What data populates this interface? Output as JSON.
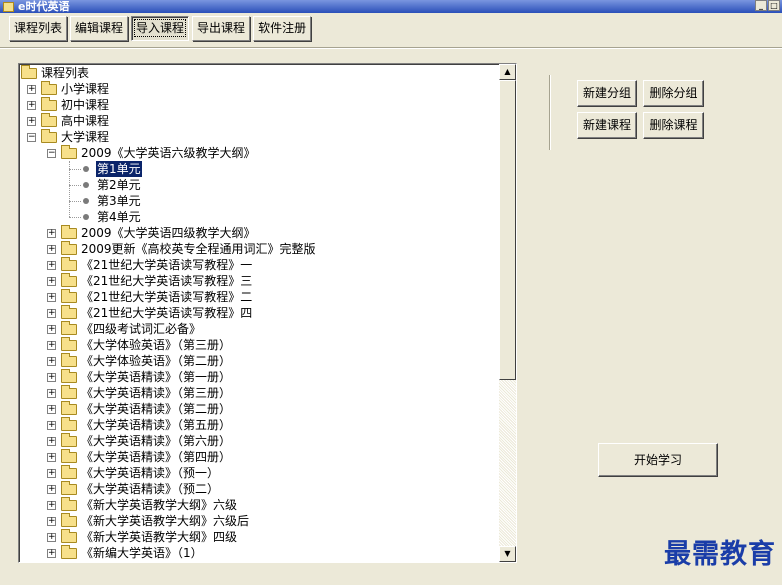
{
  "window": {
    "title": "e时代英语",
    "controls": [
      "_",
      "□"
    ]
  },
  "toolbar": [
    {
      "label": "课程列表",
      "active": false
    },
    {
      "label": "编辑课程",
      "active": false
    },
    {
      "label": "导入课程",
      "active": true
    },
    {
      "label": "导出课程",
      "active": false
    },
    {
      "label": "软件注册",
      "active": false
    }
  ],
  "tree": {
    "root": "课程列表",
    "nodes": [
      {
        "label": "小学课程",
        "level": 1,
        "type": "folder",
        "expanded": false
      },
      {
        "label": "初中课程",
        "level": 1,
        "type": "folder",
        "expanded": false
      },
      {
        "label": "高中课程",
        "level": 1,
        "type": "folder",
        "expanded": false
      },
      {
        "label": "大学课程",
        "level": 1,
        "type": "folder",
        "expanded": true
      },
      {
        "label": "2009《大学英语六级教学大纲》",
        "level": 2,
        "type": "folder",
        "expanded": true
      },
      {
        "label": "第1单元",
        "level": 3,
        "type": "leaf",
        "selected": true
      },
      {
        "label": "第2单元",
        "level": 3,
        "type": "leaf"
      },
      {
        "label": "第3单元",
        "level": 3,
        "type": "leaf"
      },
      {
        "label": "第4单元",
        "level": 3,
        "type": "leaf"
      },
      {
        "label": "2009《大学英语四级教学大纲》",
        "level": 2,
        "type": "folder",
        "expanded": false
      },
      {
        "label": "2009更新《高校英专全程通用词汇》完整版",
        "level": 2,
        "type": "folder",
        "expanded": false
      },
      {
        "label": "《21世纪大学英语读写教程》一",
        "level": 2,
        "type": "folder",
        "expanded": false
      },
      {
        "label": "《21世纪大学英语读写教程》三",
        "level": 2,
        "type": "folder",
        "expanded": false
      },
      {
        "label": "《21世纪大学英语读写教程》二",
        "level": 2,
        "type": "folder",
        "expanded": false
      },
      {
        "label": "《21世纪大学英语读写教程》四",
        "level": 2,
        "type": "folder",
        "expanded": false
      },
      {
        "label": "《四级考试词汇必备》",
        "level": 2,
        "type": "folder",
        "expanded": false
      },
      {
        "label": "《大学体验英语》（第三册）",
        "level": 2,
        "type": "folder",
        "expanded": false
      },
      {
        "label": "《大学体验英语》（第二册）",
        "level": 2,
        "type": "folder",
        "expanded": false
      },
      {
        "label": "《大学英语精读》（第一册）",
        "level": 2,
        "type": "folder",
        "expanded": false
      },
      {
        "label": "《大学英语精读》（第三册）",
        "level": 2,
        "type": "folder",
        "expanded": false
      },
      {
        "label": "《大学英语精读》（第二册）",
        "level": 2,
        "type": "folder",
        "expanded": false
      },
      {
        "label": "《大学英语精读》（第五册）",
        "level": 2,
        "type": "folder",
        "expanded": false
      },
      {
        "label": "《大学英语精读》（第六册）",
        "level": 2,
        "type": "folder",
        "expanded": false
      },
      {
        "label": "《大学英语精读》（第四册）",
        "level": 2,
        "type": "folder",
        "expanded": false
      },
      {
        "label": "《大学英语精读》（预一）",
        "level": 2,
        "type": "folder",
        "expanded": false
      },
      {
        "label": "《大学英语精读》（预二）",
        "level": 2,
        "type": "folder",
        "expanded": false
      },
      {
        "label": "《新大学英语教学大纲》六级",
        "level": 2,
        "type": "folder",
        "expanded": false
      },
      {
        "label": "《新大学英语教学大纲》六级后",
        "level": 2,
        "type": "folder",
        "expanded": false
      },
      {
        "label": "《新大学英语教学大纲》四级",
        "level": 2,
        "type": "folder",
        "expanded": false
      },
      {
        "label": "《新编大学英语》（1）",
        "level": 2,
        "type": "folder",
        "expanded": false
      }
    ]
  },
  "actions": {
    "new_group": "新建分组",
    "delete_group": "删除分组",
    "new_course": "新建课程",
    "delete_course": "删除课程",
    "start_study": "开始学习"
  },
  "watermark": "最需教育"
}
